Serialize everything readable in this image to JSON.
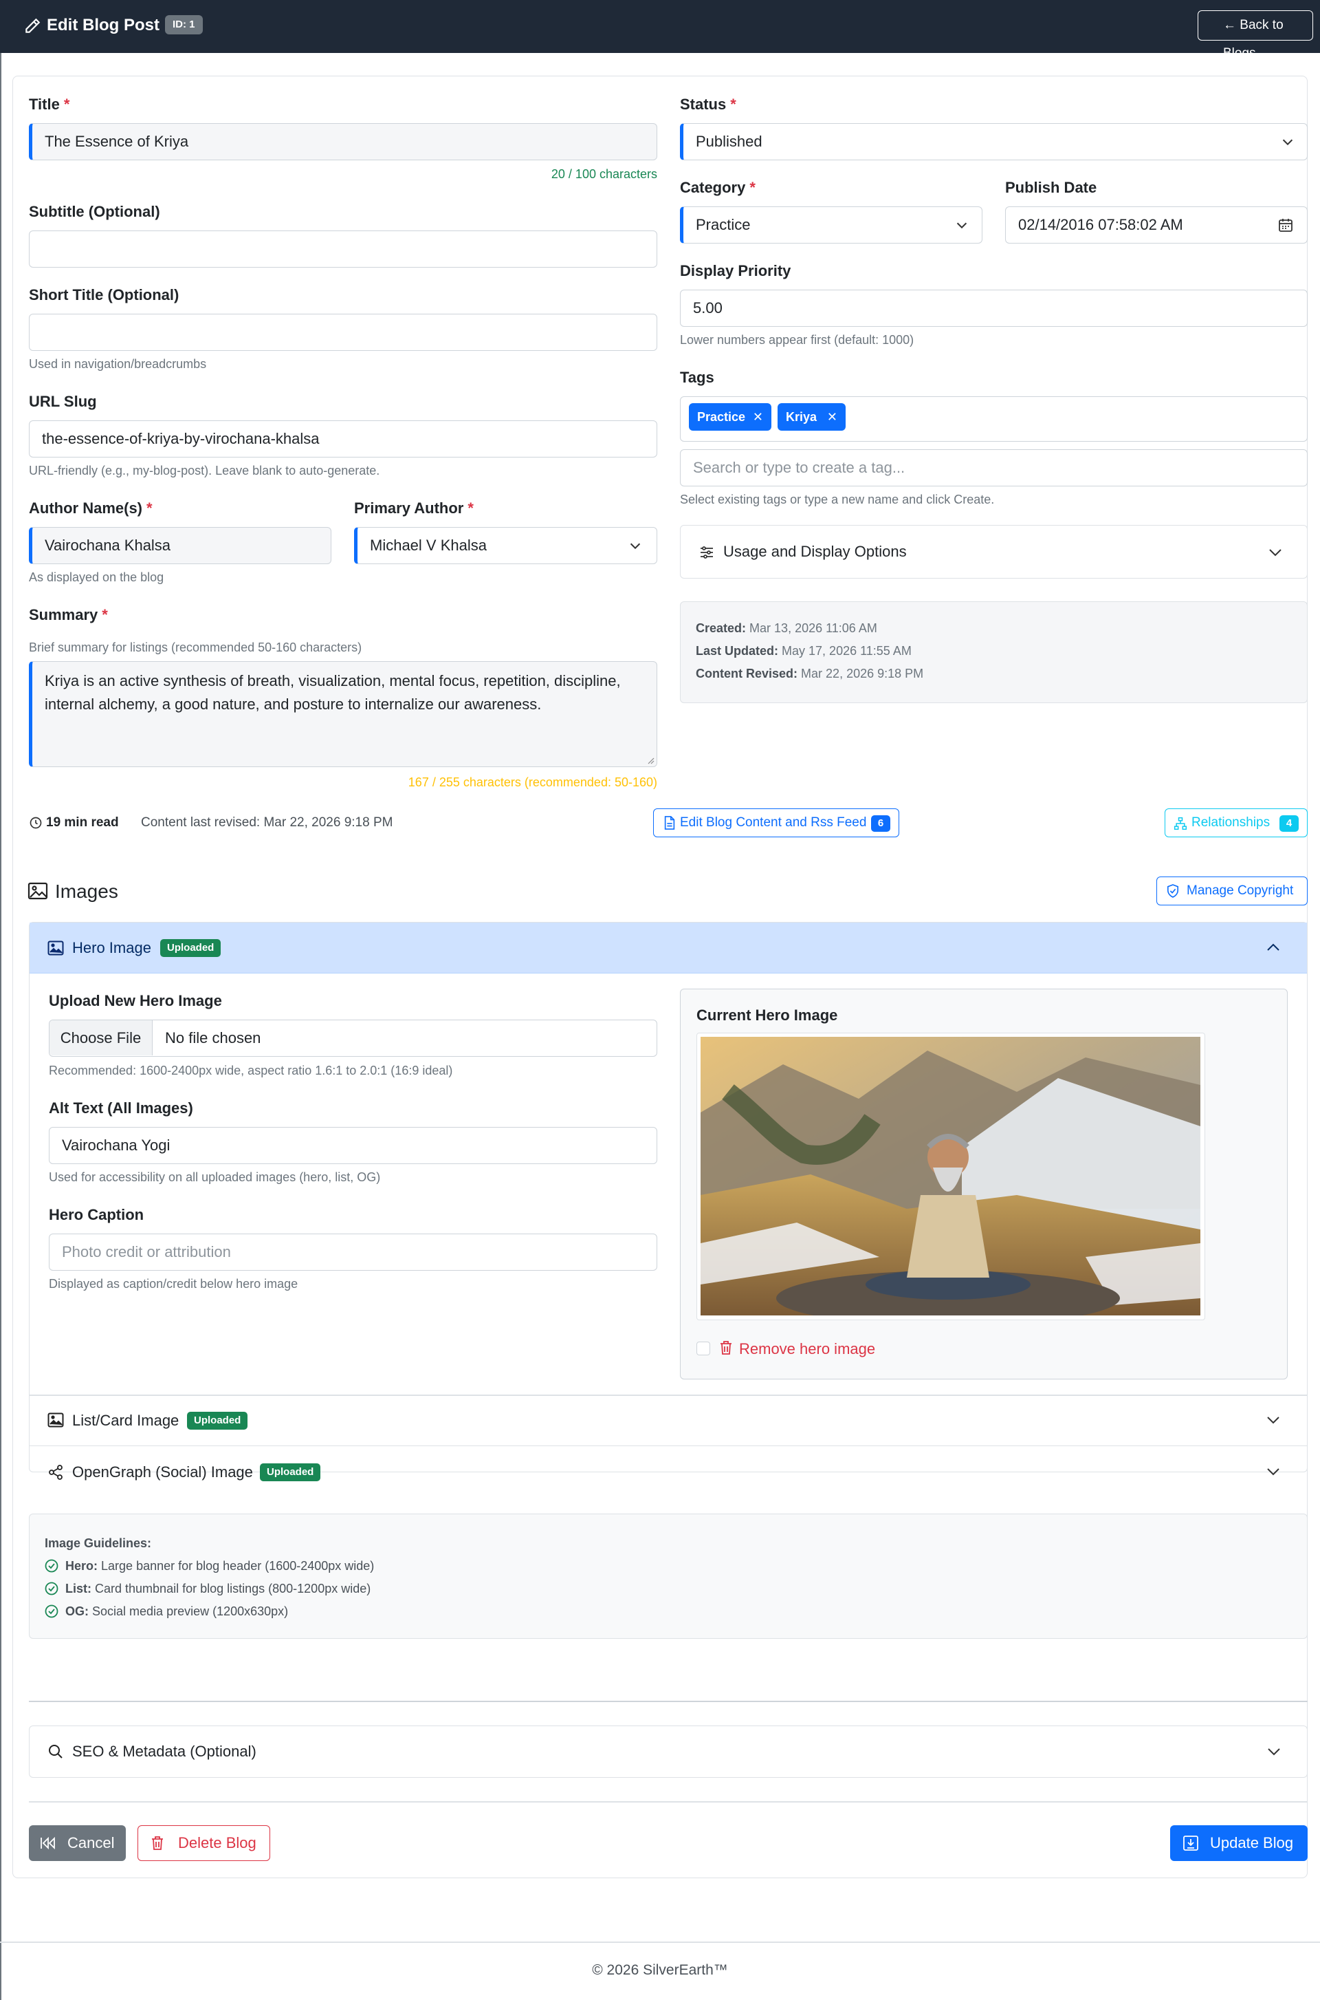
{
  "header": {
    "title": "Edit Blog Post",
    "id_badge": "ID: 1",
    "back_label": "← Back to Blogs"
  },
  "form": {
    "title": {
      "label": "Title",
      "value": "The Essence of Kriya",
      "counter": "20 / 100 characters"
    },
    "subtitle": {
      "label": "Subtitle (Optional)",
      "value": ""
    },
    "short_title": {
      "label": "Short Title (Optional)",
      "value": "",
      "help": "Used in navigation/breadcrumbs"
    },
    "slug": {
      "label": "URL Slug",
      "value": "the-essence-of-kriya-by-virochana-khalsa",
      "help": "URL-friendly (e.g., my-blog-post). Leave blank to auto-generate."
    },
    "author_names": {
      "label": "Author Name(s)",
      "value": "Vairochana Khalsa",
      "help": "As displayed on the blog"
    },
    "primary_author": {
      "label": "Primary Author",
      "value": "Michael V Khalsa"
    },
    "summary": {
      "label": "Summary",
      "help": "Brief summary for listings (recommended 50-160 characters)",
      "value": "Kriya is an active synthesis of breath, visualization, mental focus, repetition, discipline, internal alchemy, a good nature, and posture to internalize our awareness.",
      "counter": "167 / 255 characters (recommended: 50-160)"
    },
    "status": {
      "label": "Status",
      "value": "Published"
    },
    "category": {
      "label": "Category",
      "value": "Practice"
    },
    "publish_date": {
      "label": "Publish Date",
      "value": "02/14/2016 07:58:02  AM"
    },
    "display_priority": {
      "label": "Display Priority",
      "value": "5.00",
      "help": "Lower numbers appear first (default: 1000)"
    },
    "tags": {
      "label": "Tags",
      "items": [
        "Practice",
        "Kriya"
      ],
      "search_placeholder": "Search or type to create a tag...",
      "help": "Select existing tags or type a new name and click Create."
    },
    "usage_options": {
      "label": "Usage and Display Options"
    },
    "meta": {
      "created_label": "Created:",
      "created": "Mar 13, 2026 11:06 AM",
      "updated_label": "Last Updated:",
      "updated": "May 17, 2026 11:55 AM",
      "revised_label": "Content Revised:",
      "revised": "Mar 22, 2026 9:18 PM"
    }
  },
  "stats": {
    "read_time": "19 min read",
    "revised_text": "Content last revised: Mar 22, 2026 9:18 PM",
    "edit_content_label": "Edit Blog Content and Rss Feed",
    "edit_content_count": "6",
    "relationships_label": "Relationships",
    "relationships_count": "4"
  },
  "images": {
    "section_title": "Images",
    "manage_copyright": "Manage Copyright",
    "hero": {
      "title": "Hero Image",
      "badge": "Uploaded",
      "upload_label": "Upload New Hero Image",
      "choose_file": "Choose File",
      "no_file": "No file chosen",
      "upload_help": "Recommended: 1600-2400px wide, aspect ratio 1.6:1 to 2.0:1 (16:9 ideal)",
      "alt_label": "Alt Text (All Images)",
      "alt_value": "Vairochana Yogi",
      "alt_help": "Used for accessibility on all uploaded images (hero, list, OG)",
      "caption_label": "Hero Caption",
      "caption_placeholder": "Photo credit or attribution",
      "caption_help": "Displayed as caption/credit below hero image",
      "current_label": "Current Hero Image",
      "remove_label": "Remove hero image"
    },
    "list_card": {
      "title": "List/Card Image",
      "badge": "Uploaded"
    },
    "opengraph": {
      "title": "OpenGraph (Social) Image",
      "badge": "Uploaded"
    },
    "guidelines": {
      "title": "Image Guidelines:",
      "items": [
        {
          "label": "Hero:",
          "text": "Large banner for blog header (1600-2400px wide)"
        },
        {
          "label": "List:",
          "text": "Card thumbnail for blog listings (800-1200px wide)"
        },
        {
          "label": "OG:",
          "text": "Social media preview (1200x630px)"
        }
      ]
    }
  },
  "seo": {
    "title": "SEO & Metadata (Optional)"
  },
  "actions": {
    "cancel": "Cancel",
    "delete": "Delete Blog",
    "update": "Update Blog"
  },
  "footer": {
    "text": "© 2026 SilverEarth™"
  },
  "colors": {
    "primary": "#0d6efd",
    "danger": "#dc3545",
    "success": "#198754",
    "warning": "#ffc107",
    "header_bg": "#1f2937",
    "info": "#0dcaf0"
  }
}
